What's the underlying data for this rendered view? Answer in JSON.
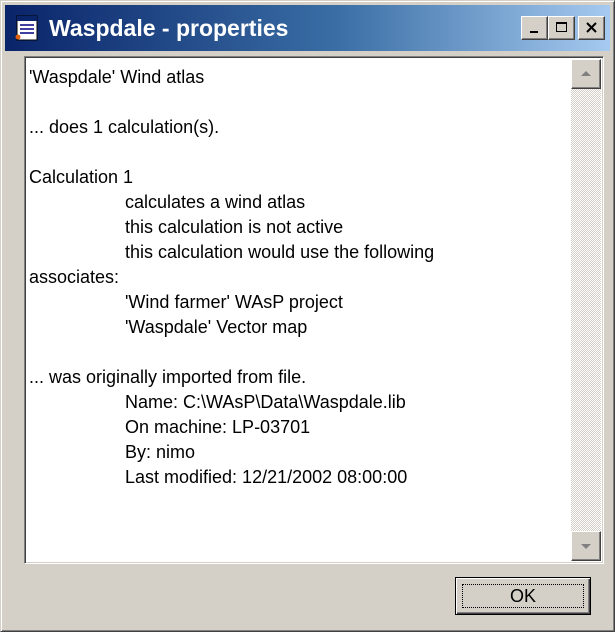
{
  "window": {
    "title": "Waspdale - properties",
    "icon": "properties-document-icon",
    "controls": {
      "minimize_icon": "minimize-icon",
      "maximize_icon": "maximize-icon",
      "close_icon": "close-icon"
    }
  },
  "content": {
    "lines": [
      "'Waspdale' Wind atlas",
      "",
      "... does 1 calculation(s).",
      "",
      "Calculation 1",
      "calculates a wind atlas",
      "this calculation is not active",
      "this calculation would use the following",
      "associates:",
      "'Wind farmer' WAsP project",
      "'Waspdale' Vector map",
      "",
      "... was originally imported from file.",
      "Name: C:\\WAsP\\Data\\Waspdale.lib",
      "On machine: LP-03701",
      "By: nimo",
      "Last modified: 12/21/2002 08:00:00"
    ]
  },
  "scrollbar": {
    "up_icon": "scroll-up-arrow-icon",
    "down_icon": "scroll-down-arrow-icon"
  },
  "buttons": {
    "ok_label": "OK"
  },
  "colors": {
    "titlebar_start": "#0a246a",
    "titlebar_end": "#a6caf0",
    "face": "#d4d0c8"
  }
}
